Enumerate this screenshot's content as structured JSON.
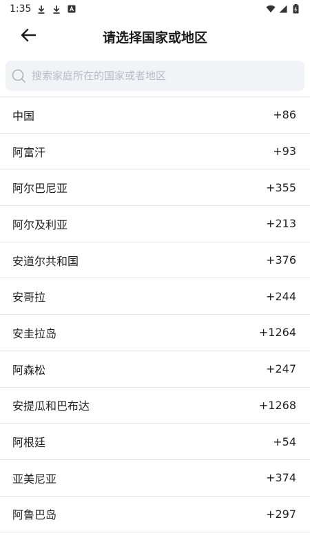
{
  "status_bar": {
    "time": "1:35"
  },
  "header": {
    "title": "请选择国家或地区"
  },
  "search": {
    "placeholder": "搜索家庭所在的国家或者地区",
    "value": ""
  },
  "countries": [
    {
      "name": "中国",
      "code": "+86"
    },
    {
      "name": "阿富汗",
      "code": "+93"
    },
    {
      "name": "阿尔巴尼亚",
      "code": "+355"
    },
    {
      "name": "阿尔及利亚",
      "code": "+213"
    },
    {
      "name": "安道尔共和国",
      "code": "+376"
    },
    {
      "name": "安哥拉",
      "code": "+244"
    },
    {
      "name": "安圭拉岛",
      "code": "+1264"
    },
    {
      "name": "阿森松",
      "code": "+247"
    },
    {
      "name": "安提瓜和巴布达",
      "code": "+1268"
    },
    {
      "name": "阿根廷",
      "code": "+54"
    },
    {
      "name": "亚美尼亚",
      "code": "+374"
    },
    {
      "name": "阿鲁巴岛",
      "code": "+297"
    }
  ],
  "icons": {
    "back": "arrow-left-icon",
    "search": "search-icon",
    "status": [
      "download-icon",
      "download-icon",
      "font-app-icon",
      "wifi-icon",
      "signal-icon",
      "battery-icon"
    ]
  },
  "colors": {
    "search_bg": "#f1f3f7",
    "divider": "#e3e3e3",
    "placeholder": "#b9bcc4"
  }
}
